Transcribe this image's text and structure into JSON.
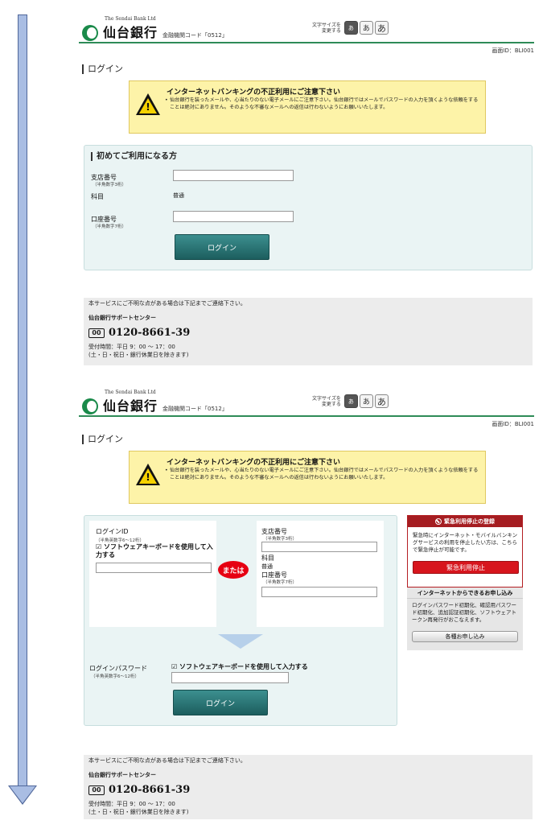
{
  "header": {
    "bank_name_en": "The Sendai Bank Ltd",
    "bank_name_jp": "仙台銀行",
    "institution_code": "金融機関コード「0512」",
    "font_size_label_1": "文字サイズを",
    "font_size_label_2": "変更する",
    "font_size_small": "あ",
    "font_size_medium": "あ",
    "font_size_large": "あ",
    "screen_id": "画面ID：BLI001"
  },
  "page_title": "ログイン",
  "notice": {
    "title": "インターネットバンキングの不正利用にご注意下さい",
    "body": "仙台銀行を装ったメールや、心当たりのない電子メールにご注意下さい。仙台銀行ではメールでパスワードの入力を頂くような依頼をすることは絶対にありません。そのような不審なメールへの返信は行わないようにお願いいたします。"
  },
  "first_time": {
    "title": "初めてご利用になる方",
    "branch_label": "支店番号",
    "branch_sub": "（半角数字3桁）",
    "branch_value": "",
    "subject_label": "科目",
    "subject_value": "普通",
    "account_label": "口座番号",
    "account_sub": "（半角数字7桁）",
    "account_value": "",
    "login_button": "ログイン"
  },
  "support": {
    "intro": "本サービスにご不明な点がある場合は下記までご連絡下さい。",
    "name": "仙台銀行サポートセンター",
    "freedial": "00",
    "phone": "0120-8661-39",
    "hours_1": "受付時間：平日 9：00 ～ 17：00",
    "hours_2": "(土・日・祝日・銀行休業日を除きます)"
  },
  "login2": {
    "login_id_label": "ログインID",
    "login_id_sub": "（半角英数字6～12桁）",
    "soft_keyboard_1": "☑ ソフトウェアキーボードを使用して入力する",
    "login_id_value": "",
    "or_label": "または",
    "branch_label": "支店番号",
    "branch_sub": "（半角数字3桁）",
    "branch_value": "",
    "subject_label": "科目",
    "subject_value": "普通",
    "account_label": "口座番号",
    "account_sub": "（半角数字7桁）",
    "account_value": "",
    "password_label": "ログインパスワード",
    "password_sub": "（半角英数字6～12桁）",
    "soft_keyboard_2": "☑ ソフトウェアキーボードを使用して入力する",
    "password_value": "",
    "login_button": "ログイン"
  },
  "emergency": {
    "title": "緊急利用停止の登録",
    "body": "緊急時にインターネット・モバイルバンキングサービスの利用を停止したい方は、こちらで緊急停止が可能です。",
    "button": "緊急利用停止"
  },
  "applications": {
    "title": "インターネットからできるお申し込み",
    "body": "ログインパスワード初期化、確認用パスワード初期化、追加認証初期化、ソフトウェアトークン再発行がおこなえます。",
    "button": "各種お申し込み"
  },
  "colors": {
    "brand_green": "#2e8b57",
    "button_teal": "#1c5e5e",
    "alert_red": "#d7151d",
    "notice_yellow": "#fdf3a8"
  }
}
